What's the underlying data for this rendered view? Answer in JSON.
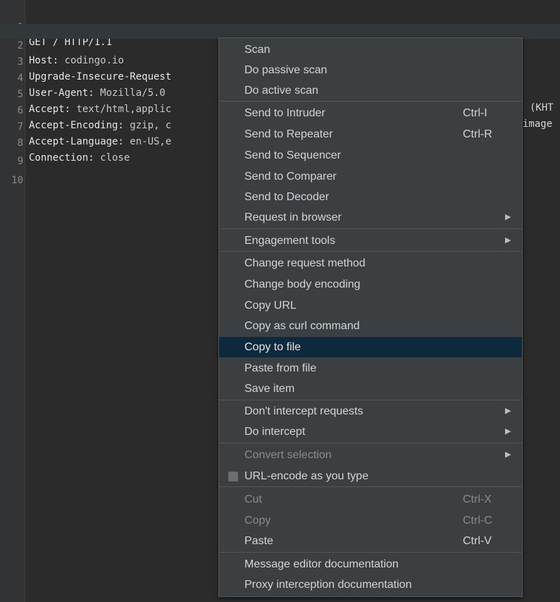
{
  "editor": {
    "lines": [
      {
        "num": "1",
        "key": "GET / HTTP/1.1",
        "value": "",
        "tail": ""
      },
      {
        "num": "2",
        "key": "Host:",
        "value": " codingo.io",
        "tail": ""
      },
      {
        "num": "3",
        "key": "Upgrade-Insecure-Request",
        "value": "",
        "tail": ""
      },
      {
        "num": "4",
        "key": "User-Agent:",
        "value": " Mozilla/5.0",
        "tail": "(KHT"
      },
      {
        "num": "5",
        "key": "Accept:",
        "value": " text/html,applic",
        "tail": "image"
      },
      {
        "num": "6",
        "key": "Accept-Encoding:",
        "value": " gzip, c",
        "tail": ""
      },
      {
        "num": "7",
        "key": "Accept-Language:",
        "value": " en-US,e",
        "tail": ""
      },
      {
        "num": "8",
        "key": "Connection:",
        "value": " close",
        "tail": ""
      },
      {
        "num": "9",
        "key": "",
        "value": "",
        "tail": ""
      },
      {
        "num": "10",
        "key": "",
        "value": "",
        "tail": ""
      }
    ]
  },
  "menu": {
    "scan": "Scan",
    "passive": "Do passive scan",
    "active": "Do active scan",
    "intruder": "Send to Intruder",
    "intruder_sc": "Ctrl-I",
    "repeater": "Send to Repeater",
    "repeater_sc": "Ctrl-R",
    "sequencer": "Send to Sequencer",
    "comparer": "Send to Comparer",
    "decoder": "Send to Decoder",
    "browser": "Request in browser",
    "engagement": "Engagement tools",
    "change_method": "Change request method",
    "change_body": "Change body encoding",
    "copy_url": "Copy URL",
    "copy_curl": "Copy as curl command",
    "copy_file": "Copy to file",
    "paste_file": "Paste from file",
    "save_item": "Save item",
    "dont_intercept": "Don't intercept requests",
    "do_intercept": "Do intercept",
    "convert": "Convert selection",
    "url_encode": "URL-encode as you type",
    "cut": "Cut",
    "cut_sc": "Ctrl-X",
    "copy": "Copy",
    "copy_sc": "Ctrl-C",
    "paste": "Paste",
    "paste_sc": "Ctrl-V",
    "msg_doc": "Message editor documentation",
    "proxy_doc": "Proxy interception documentation",
    "submenu_arrow": "▶"
  }
}
